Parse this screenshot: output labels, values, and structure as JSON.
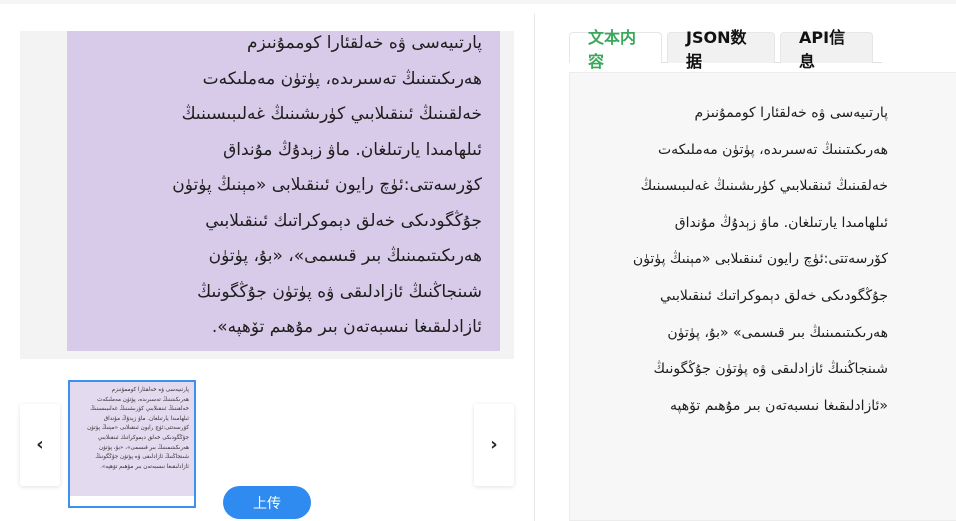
{
  "viewer": {
    "document_lines": [
      "پارتىيەسى ۋە خەلقئارا كوممۇنىزم",
      "ھەرىكىتىنىڭ تەسىرىدە، پۈتۈن مەملىكەت",
      "خەلقىنىڭ ئىنقىلابىي كۈرىشىنىڭ غەلىبىسىنىڭ",
      "ئىلھامىدا يارتىلغان. ماۋ زېدۇڭ مۇنداق",
      "كۆرسەتتى:ئۈچ رايون ئىنقىلابى «مېنىڭ پۈتۈن",
      "جۇڭگودىكى خەلق دېموكراتىك ئىنقىلابىي",
      "ھەرىكىتىمىنىڭ بىر قىسمى»، «بۇ، پۈتۈن",
      "شىنجاڭنىڭ ئازادلىقى ۋە پۈتۈن جۇڭگونىڭ",
      "ئازادلىقىغا نىسبەتەن بىر مۇھىم تۆھپە»."
    ],
    "prev_icon": "chevron-left-icon",
    "next_icon": "chevron-right-icon",
    "prev_label": "‹",
    "next_label": "›"
  },
  "upload_button": {
    "label": "上传"
  },
  "tabs": [
    {
      "label": "文本内容",
      "active": true
    },
    {
      "label": "JSON数据",
      "active": false
    },
    {
      "label": "API信息",
      "active": false
    }
  ],
  "result": {
    "lines": [
      "پارتىيەسى ۋە خەلقئارا كوممۇنىزم",
      "ھەرىكىتىنىڭ تەسىرىدە، پۈتۈن مەملىكەت",
      "خەلقىنىڭ ئىنقىلابىي كۈرىشىنىڭ غەلىبىسىنىڭ",
      "ئىلھامىدا يارتىلغان. ماۋ زېدۇڭ مۇنداق",
      "كۆرسەتتى:ئۈچ رايون ئىنقىلابى «مېنىڭ پۈتۈن",
      "جۇڭگودىكى خەلق دېموكراتىك ئىنقىلابىي",
      "ھەرىكىتىمىنىڭ بىر قىسمى» «بۇ، پۈتۈن",
      "شىنجاڭنىڭ ئازادلىقى ۋە پۈتۈن جۇڭگونىڭ",
      "«ئازادلىقىغا نىسبەتەن بىر مۇھىم تۆھپە"
    ]
  },
  "colors": {
    "accent": "#2f8bf0",
    "active_tab": "#3aa85a",
    "document_bg": "#d8cbe9"
  }
}
